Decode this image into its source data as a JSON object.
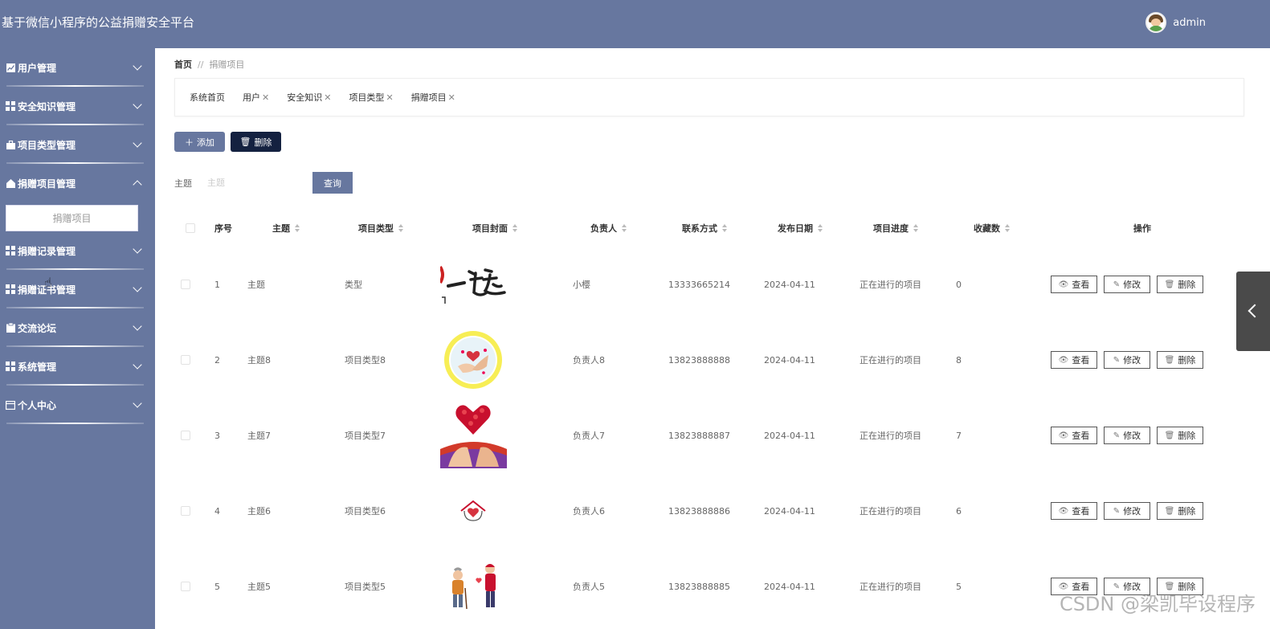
{
  "app": {
    "title": "基于微信小程序的公益捐赠安全平台"
  },
  "user": {
    "name": "admin"
  },
  "sidebar": {
    "items": [
      {
        "label": "用户管理",
        "icon": "chart-icon"
      },
      {
        "label": "安全知识管理",
        "icon": "grid-icon"
      },
      {
        "label": "项目类型管理",
        "icon": "briefcase-icon"
      },
      {
        "label": "捐赠项目管理",
        "icon": "house-icon",
        "expanded": true,
        "sub": "捐赠项目"
      },
      {
        "label": "捐赠记录管理",
        "icon": "grid-icon"
      },
      {
        "label": "捐赠证书管理",
        "icon": "grid-icon"
      },
      {
        "label": "交流论坛",
        "icon": "clipboard-icon"
      },
      {
        "label": "系统管理",
        "icon": "grid-icon"
      },
      {
        "label": "个人中心",
        "icon": "card-icon"
      }
    ]
  },
  "breadcrumb": {
    "home": "首页",
    "sep": "//",
    "current": "捐赠项目"
  },
  "tabs": [
    {
      "label": "系统首页",
      "closable": false
    },
    {
      "label": "用户",
      "closable": true
    },
    {
      "label": "安全知识",
      "closable": true
    },
    {
      "label": "项目类型",
      "closable": true
    },
    {
      "label": "捐赠项目",
      "closable": true
    }
  ],
  "toolbar": {
    "add_label": "添加",
    "delete_label": "删除"
  },
  "search": {
    "label": "主题",
    "placeholder": "主题",
    "button": "查询"
  },
  "table": {
    "headers": [
      "序号",
      "主题",
      "项目类型",
      "项目封面",
      "负责人",
      "联系方式",
      "发布日期",
      "项目进度",
      "收藏数",
      "操作"
    ],
    "rows": [
      {
        "index": "1",
        "subject": "主题",
        "type": "类型",
        "cover": "calligraphy",
        "owner": "小樱",
        "phone": "13333665214",
        "date": "2024-04-11",
        "progress": "正在进行的项目",
        "favorites": "0"
      },
      {
        "index": "2",
        "subject": "主题8",
        "type": "项目类型8",
        "cover": "hands-heart-circle",
        "owner": "负责人8",
        "phone": "13823888888",
        "date": "2024-04-11",
        "progress": "正在进行的项目",
        "favorites": "8"
      },
      {
        "index": "3",
        "subject": "主题7",
        "type": "项目类型7",
        "cover": "heart-hands",
        "owner": "负责人7",
        "phone": "13823888887",
        "date": "2024-04-11",
        "progress": "正在进行的项目",
        "favorites": "7"
      },
      {
        "index": "4",
        "subject": "主题6",
        "type": "项目类型6",
        "cover": "heart-house",
        "owner": "负责人6",
        "phone": "13823888886",
        "date": "2024-04-11",
        "progress": "正在进行的项目",
        "favorites": "6"
      },
      {
        "index": "5",
        "subject": "主题5",
        "type": "项目类型5",
        "cover": "elder-helper",
        "owner": "负责人5",
        "phone": "13823888885",
        "date": "2024-04-11",
        "progress": "正在进行的项目",
        "favorites": "5"
      }
    ],
    "actions": {
      "view": "查看",
      "edit": "修改",
      "delete": "删除"
    }
  },
  "watermark": "CSDN @梁凯毕设程序",
  "colors": {
    "primary": "#67779f",
    "dark_button": "#142140"
  }
}
